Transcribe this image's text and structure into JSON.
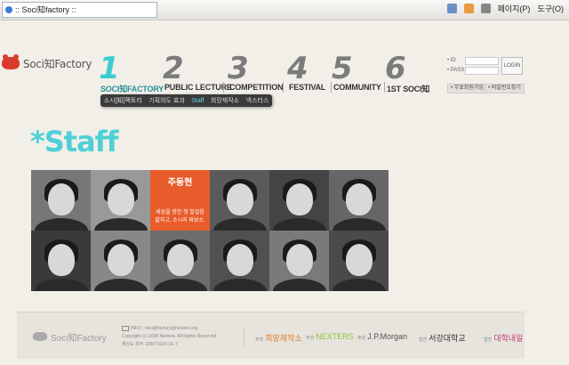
{
  "browser": {
    "tab_title": ":: Soci知factory ::",
    "tools": [
      "페이지(P)",
      "도구(O)"
    ]
  },
  "logo": {
    "text": "Soci知Factory"
  },
  "nav": [
    {
      "num": "1",
      "label": "SOCI知FACTORY",
      "active": true
    },
    {
      "num": "2",
      "label": "PUBLIC LECTURE",
      "active": false
    },
    {
      "num": "3",
      "label": "COMPETITION",
      "active": false
    },
    {
      "num": "4",
      "label": "FESTIVAL",
      "active": false
    },
    {
      "num": "5",
      "label": "COMMUNITY",
      "active": false
    },
    {
      "num": "6",
      "label": "1ST SOCI知",
      "active": false
    }
  ],
  "submenu": [
    "소시[知]팩토리",
    "기획의도 효과",
    "Staff",
    "희망제작소",
    "넥스터스"
  ],
  "login": {
    "id_label": "• ID",
    "pw_label": "• PASS",
    "button": "LOGIN",
    "join": "• 무료회원가입",
    "find": "• 비밀번호찾기"
  },
  "page_title": "*Staff",
  "staff": {
    "highlight_name": "주동현",
    "highlight_desc": "세상을 향한 첫 발걸음\n밟자고, 소시지 짜놨소."
  },
  "footer": {
    "logo": "Soci知Factory",
    "info_line1": "INFO : soci@factory@nexters.org",
    "info_line2": "Copyright (c) 2008 Nexters. All Rights Reserved.",
    "info_line3": "해상도 최적 1280*1024 | IE 7",
    "sponsors": [
      {
        "role": "주최",
        "name": "희망제작소"
      },
      {
        "role": "주관",
        "name": "NEXTERS"
      },
      {
        "role": "후원",
        "name": "J.P.Morgan"
      },
      {
        "role": "협찬",
        "name": "서강대학교"
      },
      {
        "role": "협찬",
        "name": "대학내일"
      }
    ]
  },
  "colors": {
    "accent": "#4ed0d6",
    "highlight": "#e85c2c",
    "logo_red": "#d93a2b"
  }
}
